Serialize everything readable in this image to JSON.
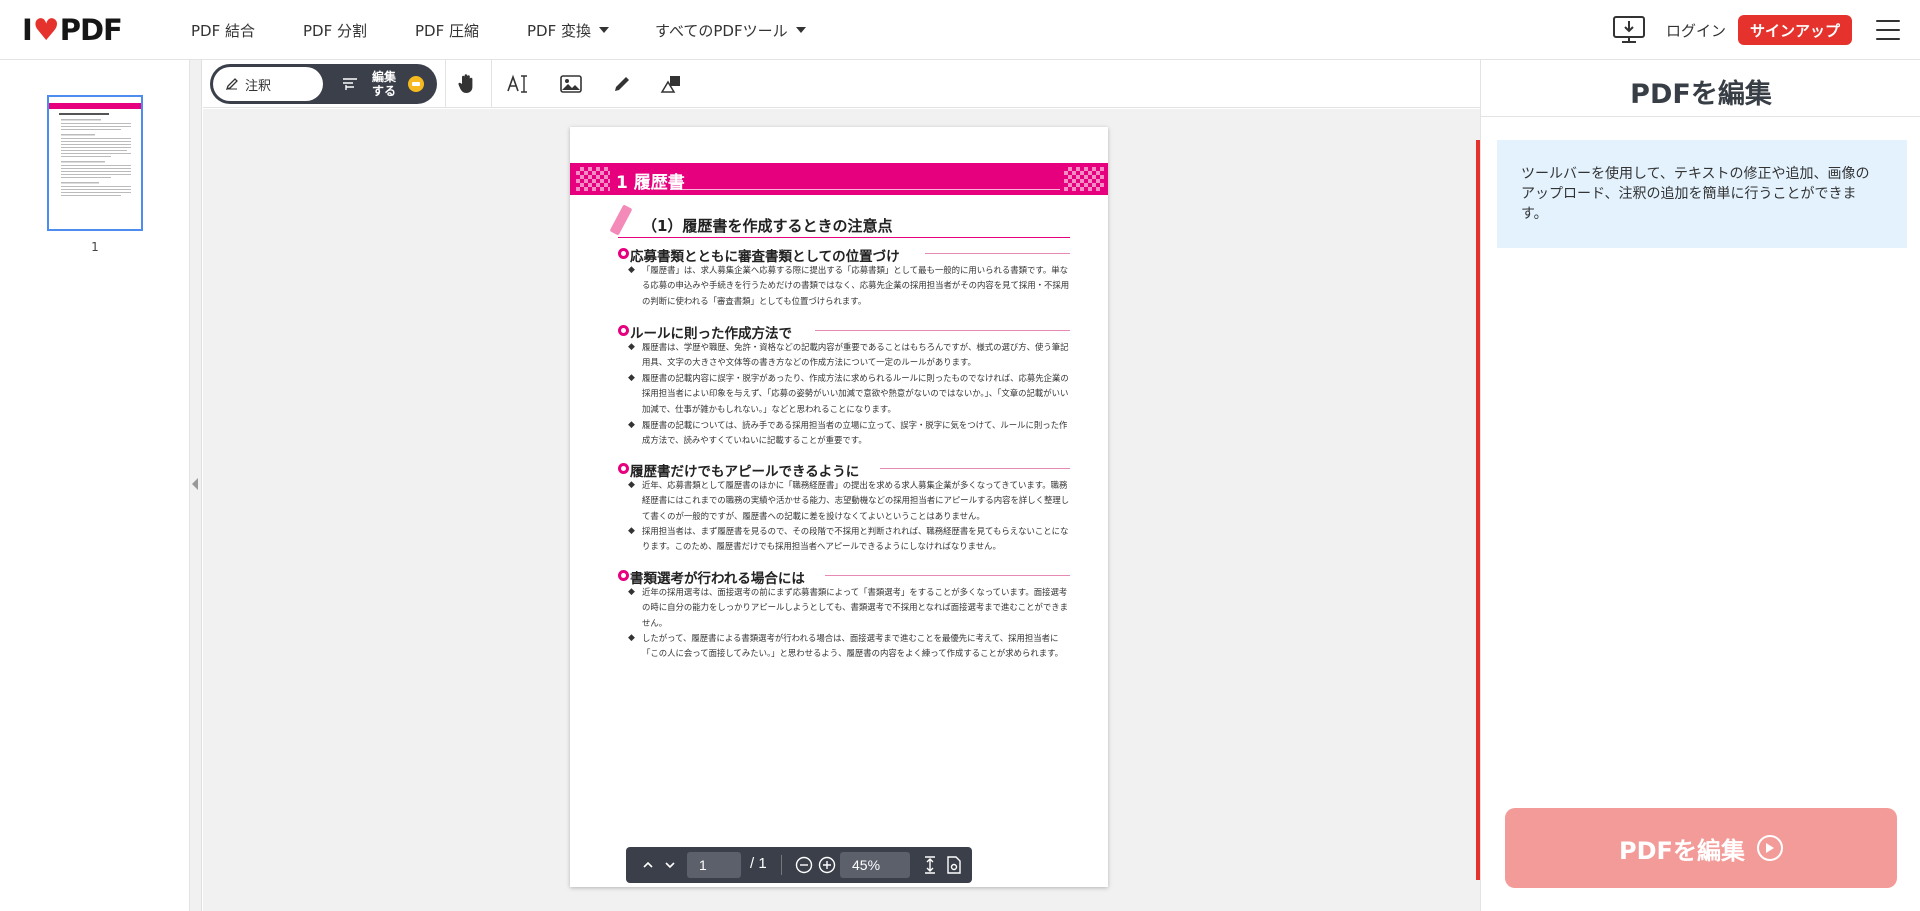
{
  "header": {
    "logo": {
      "left": "I",
      "right": "PDF"
    },
    "nav": [
      {
        "label": "PDF 結合",
        "dropdown": false
      },
      {
        "label": "PDF 分割",
        "dropdown": false
      },
      {
        "label": "PDF 圧縮",
        "dropdown": false
      },
      {
        "label": "PDF 変換",
        "dropdown": true
      },
      {
        "label": "すべてのPDFツール",
        "dropdown": true
      }
    ],
    "login_label": "ログイン",
    "signup_label": "サインアップ"
  },
  "thumbnails": [
    {
      "label": "1"
    }
  ],
  "toolbar": {
    "annotate_label": "注釈",
    "edit_label_line1": "編集",
    "edit_label_line2": "する"
  },
  "document": {
    "banner_title": "1  履歴書",
    "subheading": "（1）履歴書を作成するときの注意点",
    "sections": [
      {
        "title": "応募書類とともに審査書類としての位置づけ",
        "paragraphs": [
          "「履歴書」は、求人募集企業へ応募する際に提出する「応募書類」として最も一般的に用いられる書類です。単なる応募の申込みや手続きを行うためだけの書類ではなく、応募先企業の採用担当者がその内容を見て採用・不採用の判断に使われる「審査書類」としても位置づけられます。"
        ]
      },
      {
        "title": "ルールに則った作成方法で",
        "paragraphs": [
          "履歴書は、学歴や職歴、免許・資格などの記載内容が重要であることはもちろんですが、様式の選び方、使う筆記用具、文字の大きさや文体等の書き方などの作成方法について一定のルールがあります。",
          "履歴書の記載内容に誤字・脱字があったり、作成方法に求められるルールに則ったものでなければ、応募先企業の採用担当者によい印象を与えず、「応募の姿勢がいい加減で意欲や熱意がないのではないか。」、「文章の記載がいい加減で、仕事が雑かもしれない。」などと思われることになります。",
          "履歴書の記載については、読み手である採用担当者の立場に立って、誤字・脱字に気をつけて、ルールに則った作成方法で、読みやすくていねいに記載することが重要です。"
        ]
      },
      {
        "title": "履歴書だけでもアピールできるように",
        "paragraphs": [
          "近年、応募書類として履歴書のほかに「職務経歴書」の提出を求める求人募集企業が多くなってきています。職務経歴書にはこれまでの職務の実績や活かせる能力、志望動機などの採用担当者にアピールする内容を詳しく整理して書くのが一般的ですが、履歴書への記載に差を設けなくてよいということはありません。",
          "採用担当者は、まず履歴書を見るので、その段階で不採用と判断されれば、職務経歴書を見てもらえないことになります。このため、履歴書だけでも採用担当者へアピールできるようにしなければなりません。"
        ]
      },
      {
        "title": "書類選考が行われる場合には",
        "paragraphs": [
          "近年の採用選考は、面接選考の前にまず応募書類によって「書類選考」をすることが多くなっています。面接選考の時に自分の能力をしっかりアピールしようとしても、書類選考で不採用となれば面接選考まで進むことができません。",
          "したがって、履歴書による書類選考が行われる場合は、面接選考まで進むことを最優先に考えて、採用担当者に「この人に会って面接してみたい。」と思わせるよう、履歴書の内容をよく練って作成することが求められます。"
        ]
      }
    ]
  },
  "pager": {
    "current_page": "1",
    "total": "/ 1",
    "zoom": "45%"
  },
  "right_panel": {
    "title": "PDFを編集",
    "info": "ツールバーを使用して、テキストの修正や追加、画像のアップロード、注釈の追加を簡単に行うことができます。",
    "button_label": "PDFを編集"
  },
  "colors": {
    "brand_red": "#e5322d",
    "doc_magenta": "#e6007e",
    "button_disabled": "#f29b98",
    "info_bg": "#e3f2fd"
  }
}
